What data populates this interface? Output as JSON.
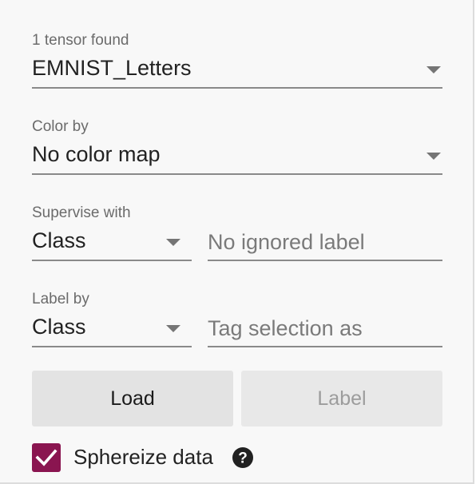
{
  "tensor": {
    "label": "1 tensor found",
    "value": "EMNIST_Letters"
  },
  "color_by": {
    "label": "Color by",
    "value": "No color map"
  },
  "supervise": {
    "label": "Supervise with",
    "value": "Class",
    "ignored_placeholder": "No ignored label"
  },
  "label_by": {
    "label": "Label by",
    "value": "Class",
    "tag_placeholder": "Tag selection as"
  },
  "buttons": {
    "load": "Load",
    "label": "Label"
  },
  "sphereize": {
    "label": "Sphereize data",
    "checked": true
  },
  "colors": {
    "checkbox": "#8a1550",
    "underline": "#8a8a8a",
    "panel_bg": "#f8f8f8"
  },
  "icons": {
    "dropdown": "triangle-down-icon",
    "help": "question-circle-icon",
    "check": "checkmark-icon"
  }
}
